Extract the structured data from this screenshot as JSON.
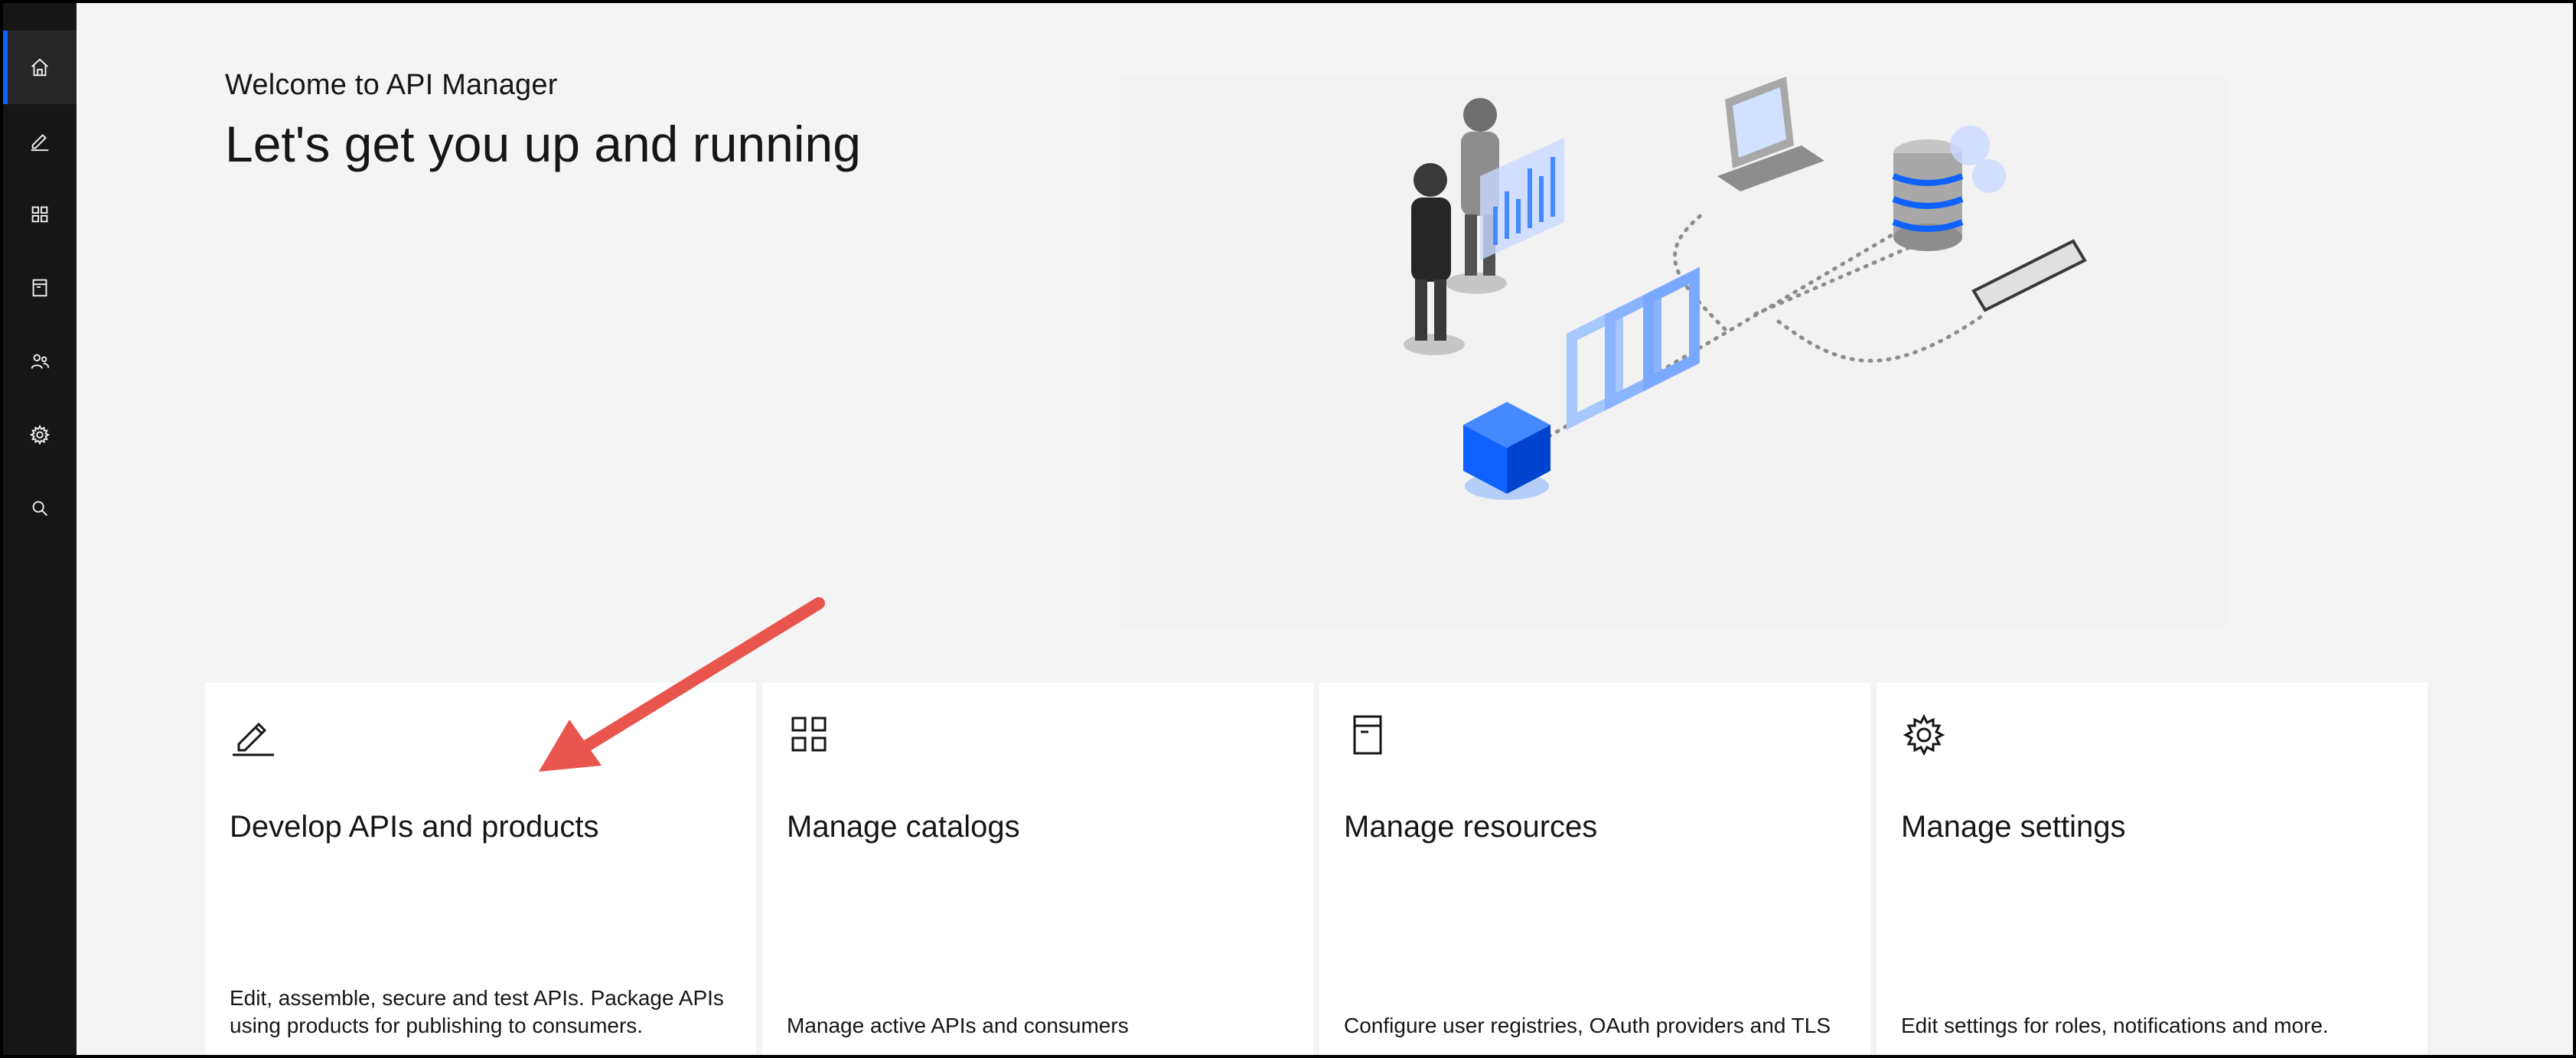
{
  "nav": {
    "items": [
      {
        "icon": "home-icon",
        "active": true
      },
      {
        "icon": "pencil-icon",
        "active": false
      },
      {
        "icon": "grid-icon",
        "active": false
      },
      {
        "icon": "archive-icon",
        "active": false
      },
      {
        "icon": "users-icon",
        "active": false
      },
      {
        "icon": "gear-icon",
        "active": false
      },
      {
        "icon": "search-icon",
        "active": false
      }
    ],
    "accent_color": "#0f62fe",
    "background_color": "#161616"
  },
  "header": {
    "welcome": "Welcome to API Manager",
    "headline": "Let's get you up and running"
  },
  "tiles": [
    {
      "icon": "pencil-icon",
      "title": "Develop APIs and products",
      "description": "Edit, assemble, secure and test APIs. Package APIs using products for publishing to consumers."
    },
    {
      "icon": "grid-icon",
      "title": "Manage catalogs",
      "description": "Manage active APIs and consumers"
    },
    {
      "icon": "archive-icon",
      "title": "Manage resources",
      "description": "Configure user registries, OAuth providers and TLS"
    },
    {
      "icon": "gear-icon",
      "title": "Manage settings",
      "description": "Edit settings for roles, notifications and more."
    }
  ],
  "annotation": {
    "icon": "arrow-icon",
    "color": "#e8554d"
  }
}
